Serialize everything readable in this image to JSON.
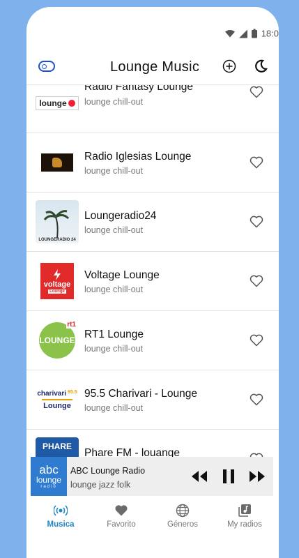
{
  "status": {
    "time": "18:0"
  },
  "header": {
    "title": "Lounge Music",
    "toggle_icon": "toggle-icon",
    "add_icon": "add-circle-icon",
    "theme_icon": "moon-icon"
  },
  "stations": [
    {
      "name": "Radio Fantasy Lounge",
      "genre": "lounge chill-out",
      "logo_text": "lounge"
    },
    {
      "name": "Radio Iglesias Lounge",
      "genre": "lounge chill-out",
      "logo_text": ""
    },
    {
      "name": "Loungeradio24",
      "genre": "lounge chill-out",
      "logo_text": "LOUNGERADIO 24"
    },
    {
      "name": "Voltage Lounge",
      "genre": "lounge chill-out",
      "logo_text": "voltage",
      "logo_sub": "Lounge"
    },
    {
      "name": "RT1 Lounge",
      "genre": "lounge chill-out",
      "logo_text": "LOUNGE",
      "logo_badge": "rt1"
    },
    {
      "name": "95.5 Charivari - Lounge",
      "genre": "lounge chill-out",
      "logo_text": "charivari",
      "logo_freq": "95.5",
      "logo_sub": "Lounge"
    },
    {
      "name": "Phare FM - louange",
      "genre": "",
      "logo_text": "PHARE"
    }
  ],
  "player": {
    "name": "ABC Lounge Radio",
    "genre": "lounge jazz folk",
    "cover_line1": "abc",
    "cover_line2": "lounge",
    "cover_line3": "radio"
  },
  "nav": [
    {
      "label": "Musica",
      "icon": "broadcast-icon",
      "active": true
    },
    {
      "label": "Favorito",
      "icon": "heart-icon",
      "active": false
    },
    {
      "label": "Géneros",
      "icon": "globe-icon",
      "active": false
    },
    {
      "label": "My radios",
      "icon": "music-library-icon",
      "active": false
    }
  ]
}
